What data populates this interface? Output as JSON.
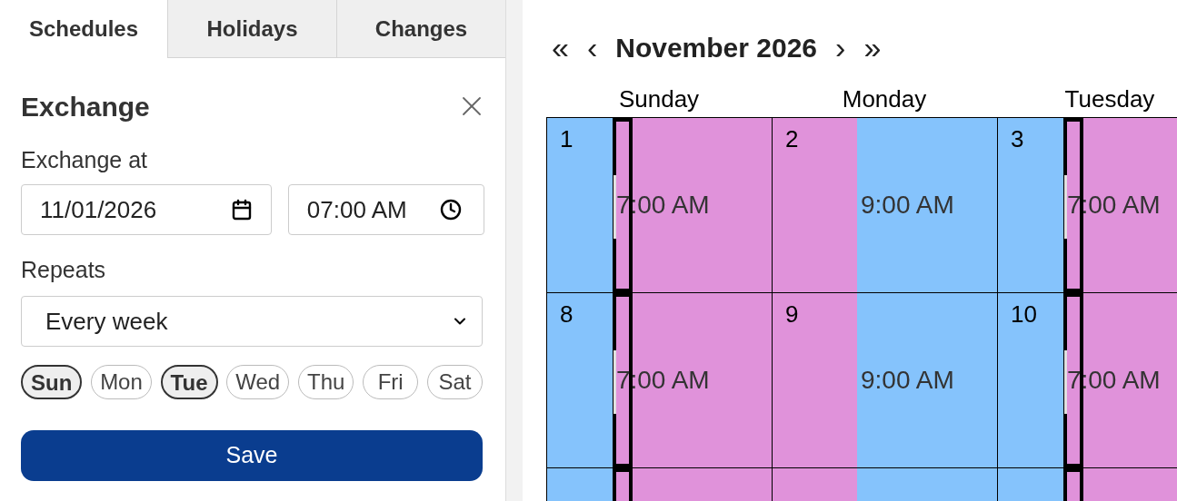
{
  "tabs": [
    {
      "label": "Schedules",
      "selected": true
    },
    {
      "label": "Holidays",
      "selected": false
    },
    {
      "label": "Changes",
      "selected": false
    }
  ],
  "form": {
    "title": "Exchange",
    "exchange_label": "Exchange at",
    "date": "11/01/2026",
    "time": "07:00 AM",
    "repeats_label": "Repeats",
    "repeats": "Every week",
    "days": [
      {
        "label": "Sun",
        "selected": true
      },
      {
        "label": "Mon",
        "selected": false
      },
      {
        "label": "Tue",
        "selected": true
      },
      {
        "label": "Wed",
        "selected": false
      },
      {
        "label": "Thu",
        "selected": false
      },
      {
        "label": "Fri",
        "selected": false
      },
      {
        "label": "Sat",
        "selected": false
      }
    ],
    "save": "Save"
  },
  "calendar": {
    "nav": {
      "first": "«",
      "prev": "‹",
      "title": "November 2026",
      "next": "›",
      "last": "»"
    },
    "weekdays": [
      "Sunday",
      "Monday",
      "Tuesday"
    ],
    "weeks": [
      {
        "days": [
          {
            "date": "1",
            "segments": [
              {
                "color": "#85c3fc"
              },
              {
                "color": "#e092da"
              }
            ],
            "level": 0.29,
            "time": "7:00 AM",
            "selected": true
          },
          {
            "date": "2",
            "segments": [
              {
                "color": "#e092da"
              },
              {
                "color": "#85c3fc"
              }
            ],
            "level": 0.375,
            "time": "9:00 AM",
            "selected": false
          },
          {
            "date": "3",
            "segments": [
              {
                "color": "#85c3fc"
              },
              {
                "color": "#e092da"
              }
            ],
            "level": 0.29,
            "time": "7:00 AM",
            "selected": true
          }
        ]
      },
      {
        "days": [
          {
            "date": "8",
            "segments": [
              {
                "color": "#85c3fc"
              },
              {
                "color": "#e092da"
              }
            ],
            "level": 0.29,
            "time": "7:00 AM",
            "selected": true
          },
          {
            "date": "9",
            "segments": [
              {
                "color": "#e092da"
              },
              {
                "color": "#85c3fc"
              }
            ],
            "level": 0.375,
            "time": "9:00 AM",
            "selected": false
          },
          {
            "date": "10",
            "segments": [
              {
                "color": "#85c3fc"
              },
              {
                "color": "#e092da"
              }
            ],
            "level": 0.29,
            "time": "7:00 AM",
            "selected": true
          }
        ]
      },
      {
        "days": [
          {
            "segments": [
              {
                "color": "#85c3fc"
              },
              {
                "color": "#e092da"
              }
            ],
            "level": 0.29,
            "selected": true
          },
          {
            "segments": [
              {
                "color": "#e092da"
              },
              {
                "color": "#85c3fc"
              }
            ],
            "level": 0.375,
            "selected": false
          },
          {
            "segments": [
              {
                "color": "#85c3fc"
              },
              {
                "color": "#e092da"
              }
            ],
            "level": 0.29,
            "selected": true
          }
        ]
      }
    ]
  }
}
